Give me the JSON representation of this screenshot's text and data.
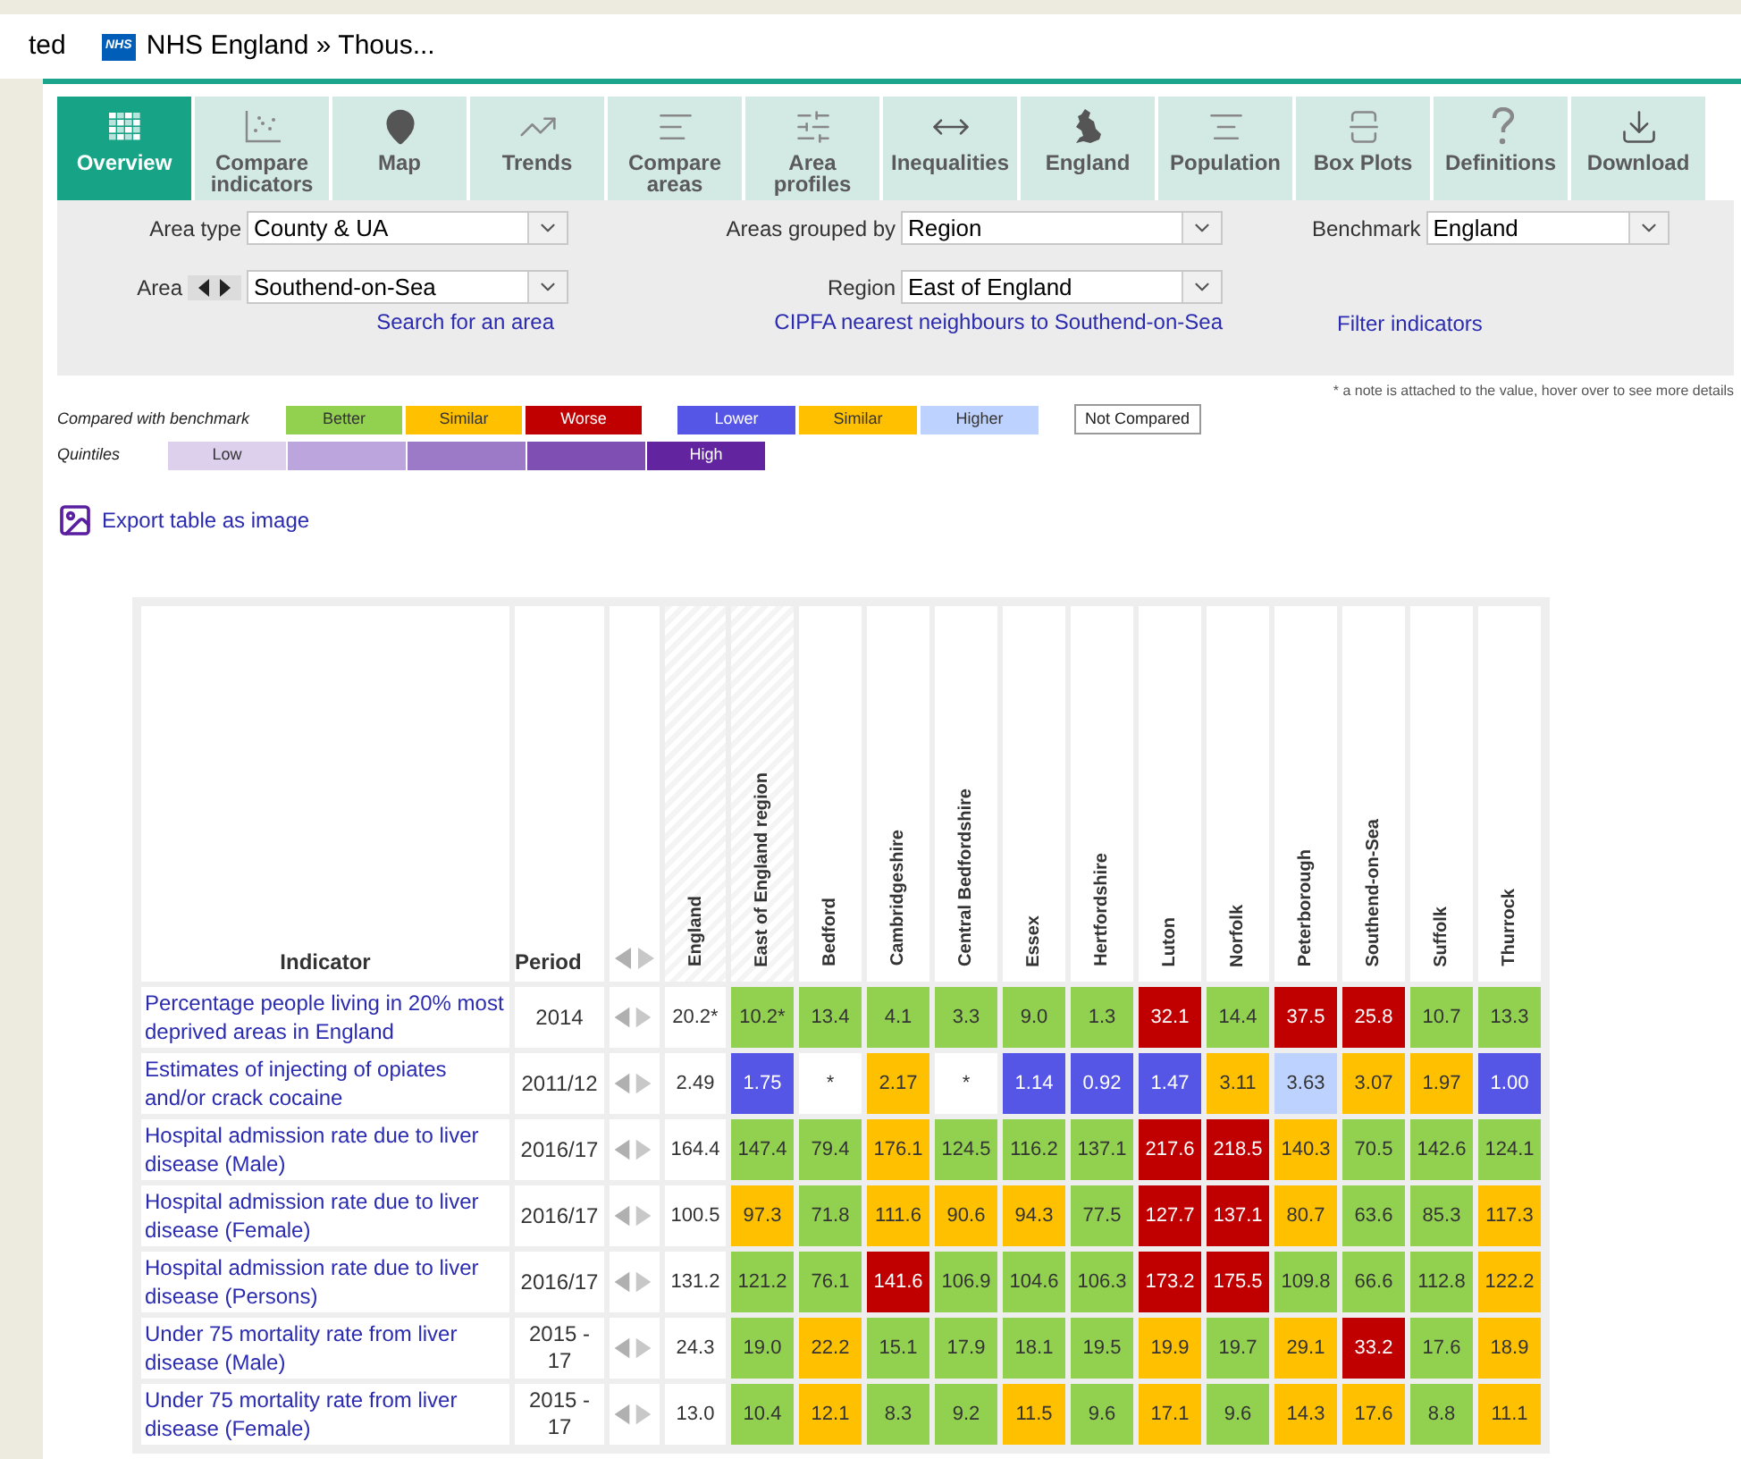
{
  "browser_tabs": [
    {
      "title": "ted"
    },
    {
      "logo": "NHS",
      "title": "NHS England » Thous..."
    }
  ],
  "tabs": [
    {
      "label": "Overview",
      "selected": true
    },
    {
      "label": "Compare indicators",
      "selected": false
    },
    {
      "label": "Map",
      "selected": false
    },
    {
      "label": "Trends",
      "selected": false
    },
    {
      "label": "Compare areas",
      "selected": false
    },
    {
      "label": "Area profiles",
      "selected": false
    },
    {
      "label": "Inequalities",
      "selected": false
    },
    {
      "label": "England",
      "selected": false
    },
    {
      "label": "Population",
      "selected": false
    },
    {
      "label": "Box Plots",
      "selected": false
    },
    {
      "label": "Definitions",
      "selected": false
    },
    {
      "label": "Download",
      "selected": false
    }
  ],
  "filters": {
    "area_type": {
      "label": "Area type",
      "value": "County & UA"
    },
    "area": {
      "label": "Area",
      "value": "Southend-on-Sea",
      "link": "Search for an area"
    },
    "grouped_by": {
      "label": "Areas grouped by",
      "value": "Region"
    },
    "region": {
      "label": "Region",
      "value": "East of England",
      "link": "CIPFA nearest neighbours to Southend-on-Sea"
    },
    "benchmark": {
      "label": "Benchmark",
      "value": "England",
      "link": "Filter indicators"
    }
  },
  "legend": {
    "note": "* a note is attached to the value, hover over to see more details",
    "benchmark_label": "Compared with benchmark",
    "benchmark_items": [
      {
        "label": "Better",
        "color": "#92d050"
      },
      {
        "label": "Similar",
        "color": "#ffc000"
      },
      {
        "label": "Worse",
        "color": "#c00000"
      }
    ],
    "benchmark_items_2": [
      {
        "label": "Lower",
        "color": "#5555e6"
      },
      {
        "label": "Similar",
        "color": "#ffc000"
      },
      {
        "label": "Higher",
        "color": "#bed2ff"
      }
    ],
    "not_compared": "Not Compared",
    "quintiles_label": "Quintiles",
    "quintiles": [
      {
        "label": "Low",
        "color": "#dcd0ec"
      },
      {
        "color": "#bca5dc"
      },
      {
        "color": "#9d7ac8"
      },
      {
        "color": "#7f4fb4"
      },
      {
        "label": "High",
        "color": "#6324a0"
      }
    ]
  },
  "export_link": "Export table as image",
  "table": {
    "columns": {
      "indicator": "Indicator",
      "period": "Period",
      "benchmark": "England",
      "areas": [
        "East of England region",
        "Bedford",
        "Cambridgeshire",
        "Central Bedfordshire",
        "Essex",
        "Hertfordshire",
        "Luton",
        "Norfolk",
        "Peterborough",
        "Southend-on-Sea",
        "Suffolk",
        "Thurrock"
      ]
    },
    "rows": [
      {
        "indicator": "Percentage people living in 20% most deprived areas in England",
        "period": "2014",
        "benchmark": "20.2*",
        "cells": [
          {
            "value": "10.2*",
            "color": "#92d050"
          },
          {
            "value": "13.4",
            "color": "#92d050"
          },
          {
            "value": "4.1",
            "color": "#92d050"
          },
          {
            "value": "3.3",
            "color": "#92d050"
          },
          {
            "value": "9.0",
            "color": "#92d050"
          },
          {
            "value": "1.3",
            "color": "#92d050"
          },
          {
            "value": "32.1",
            "color": "#c00000"
          },
          {
            "value": "14.4",
            "color": "#92d050"
          },
          {
            "value": "37.5",
            "color": "#c00000"
          },
          {
            "value": "25.8",
            "color": "#c00000"
          },
          {
            "value": "10.7",
            "color": "#92d050"
          },
          {
            "value": "13.3",
            "color": "#92d050"
          }
        ]
      },
      {
        "indicator": "Estimates of injecting of opiates and/or crack cocaine",
        "period": "2011/12",
        "benchmark": "2.49",
        "cells": [
          {
            "value": "1.75",
            "color": "#5555e6"
          },
          {
            "value": "*",
            "color": "#ffffff"
          },
          {
            "value": "2.17",
            "color": "#ffc000"
          },
          {
            "value": "*",
            "color": "#ffffff"
          },
          {
            "value": "1.14",
            "color": "#5555e6"
          },
          {
            "value": "0.92",
            "color": "#5555e6"
          },
          {
            "value": "1.47",
            "color": "#5555e6"
          },
          {
            "value": "3.11",
            "color": "#ffc000"
          },
          {
            "value": "3.63",
            "color": "#bed2ff"
          },
          {
            "value": "3.07",
            "color": "#ffc000"
          },
          {
            "value": "1.97",
            "color": "#ffc000"
          },
          {
            "value": "1.00",
            "color": "#5555e6"
          }
        ]
      },
      {
        "indicator": "Hospital admission rate due to liver disease (Male)",
        "period": "2016/17",
        "benchmark": "164.4",
        "cells": [
          {
            "value": "147.4",
            "color": "#92d050"
          },
          {
            "value": "79.4",
            "color": "#92d050"
          },
          {
            "value": "176.1",
            "color": "#ffc000"
          },
          {
            "value": "124.5",
            "color": "#92d050"
          },
          {
            "value": "116.2",
            "color": "#92d050"
          },
          {
            "value": "137.1",
            "color": "#92d050"
          },
          {
            "value": "217.6",
            "color": "#c00000"
          },
          {
            "value": "218.5",
            "color": "#c00000"
          },
          {
            "value": "140.3",
            "color": "#ffc000"
          },
          {
            "value": "70.5",
            "color": "#92d050"
          },
          {
            "value": "142.6",
            "color": "#92d050"
          },
          {
            "value": "124.1",
            "color": "#92d050"
          }
        ]
      },
      {
        "indicator": "Hospital admission rate due to liver disease (Female)",
        "period": "2016/17",
        "benchmark": "100.5",
        "cells": [
          {
            "value": "97.3",
            "color": "#ffc000"
          },
          {
            "value": "71.8",
            "color": "#92d050"
          },
          {
            "value": "111.6",
            "color": "#ffc000"
          },
          {
            "value": "90.6",
            "color": "#ffc000"
          },
          {
            "value": "94.3",
            "color": "#ffc000"
          },
          {
            "value": "77.5",
            "color": "#92d050"
          },
          {
            "value": "127.7",
            "color": "#c00000"
          },
          {
            "value": "137.1",
            "color": "#c00000"
          },
          {
            "value": "80.7",
            "color": "#ffc000"
          },
          {
            "value": "63.6",
            "color": "#92d050"
          },
          {
            "value": "85.3",
            "color": "#92d050"
          },
          {
            "value": "117.3",
            "color": "#ffc000"
          }
        ]
      },
      {
        "indicator": "Hospital admission rate due to liver disease (Persons)",
        "period": "2016/17",
        "benchmark": "131.2",
        "cells": [
          {
            "value": "121.2",
            "color": "#92d050"
          },
          {
            "value": "76.1",
            "color": "#92d050"
          },
          {
            "value": "141.6",
            "color": "#c00000"
          },
          {
            "value": "106.9",
            "color": "#92d050"
          },
          {
            "value": "104.6",
            "color": "#92d050"
          },
          {
            "value": "106.3",
            "color": "#92d050"
          },
          {
            "value": "173.2",
            "color": "#c00000"
          },
          {
            "value": "175.5",
            "color": "#c00000"
          },
          {
            "value": "109.8",
            "color": "#92d050"
          },
          {
            "value": "66.6",
            "color": "#92d050"
          },
          {
            "value": "112.8",
            "color": "#92d050"
          },
          {
            "value": "122.2",
            "color": "#ffc000"
          }
        ]
      },
      {
        "indicator": "Under 75 mortality rate from liver disease (Male)",
        "period": "2015 - 17",
        "benchmark": "24.3",
        "cells": [
          {
            "value": "19.0",
            "color": "#92d050"
          },
          {
            "value": "22.2",
            "color": "#ffc000"
          },
          {
            "value": "15.1",
            "color": "#92d050"
          },
          {
            "value": "17.9",
            "color": "#92d050"
          },
          {
            "value": "18.1",
            "color": "#92d050"
          },
          {
            "value": "19.5",
            "color": "#92d050"
          },
          {
            "value": "19.9",
            "color": "#ffc000"
          },
          {
            "value": "19.7",
            "color": "#92d050"
          },
          {
            "value": "29.1",
            "color": "#ffc000"
          },
          {
            "value": "33.2",
            "color": "#c00000"
          },
          {
            "value": "17.6",
            "color": "#92d050"
          },
          {
            "value": "18.9",
            "color": "#ffc000"
          }
        ]
      },
      {
        "indicator": "Under 75 mortality rate from liver disease (Female)",
        "period": "2015 - 17",
        "benchmark": "13.0",
        "cells": [
          {
            "value": "10.4",
            "color": "#92d050"
          },
          {
            "value": "12.1",
            "color": "#ffc000"
          },
          {
            "value": "8.3",
            "color": "#92d050"
          },
          {
            "value": "9.2",
            "color": "#92d050"
          },
          {
            "value": "11.5",
            "color": "#ffc000"
          },
          {
            "value": "9.6",
            "color": "#92d050"
          },
          {
            "value": "17.1",
            "color": "#ffc000"
          },
          {
            "value": "9.6",
            "color": "#92d050"
          },
          {
            "value": "14.3",
            "color": "#ffc000"
          },
          {
            "value": "17.6",
            "color": "#ffc000"
          },
          {
            "value": "8.8",
            "color": "#92d050"
          },
          {
            "value": "11.1",
            "color": "#ffc000"
          }
        ]
      }
    ]
  }
}
